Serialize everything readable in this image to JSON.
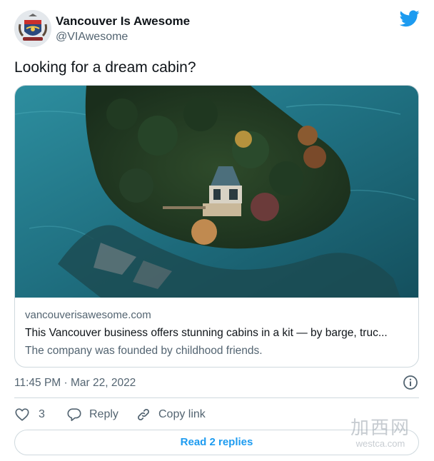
{
  "author": {
    "name": "Vancouver Is Awesome",
    "handle": "@VIAwesome"
  },
  "tweet": {
    "text": "Looking for a dream cabin?"
  },
  "card": {
    "domain": "vancouverisawesome.com",
    "title": "This Vancouver business offers stunning cabins in a kit — by barge, truc...",
    "description": "The company was founded by childhood friends."
  },
  "meta": {
    "timestamp": "11:45 PM · Mar 22, 2022"
  },
  "actions": {
    "like_count": "3",
    "reply_label": "Reply",
    "copy_label": "Copy link",
    "read_replies_label": "Read 2 replies"
  },
  "watermark": {
    "main": "加西网",
    "sub": "westca.com"
  },
  "colors": {
    "accent": "#1d9bf0",
    "text_primary": "#0f1419",
    "text_secondary": "#536471",
    "border": "#cfd9de"
  },
  "icons": {
    "logo": "twitter-bird-icon",
    "info": "info-icon",
    "like": "heart-icon",
    "reply": "speech-bubble-icon",
    "copy": "link-icon"
  }
}
